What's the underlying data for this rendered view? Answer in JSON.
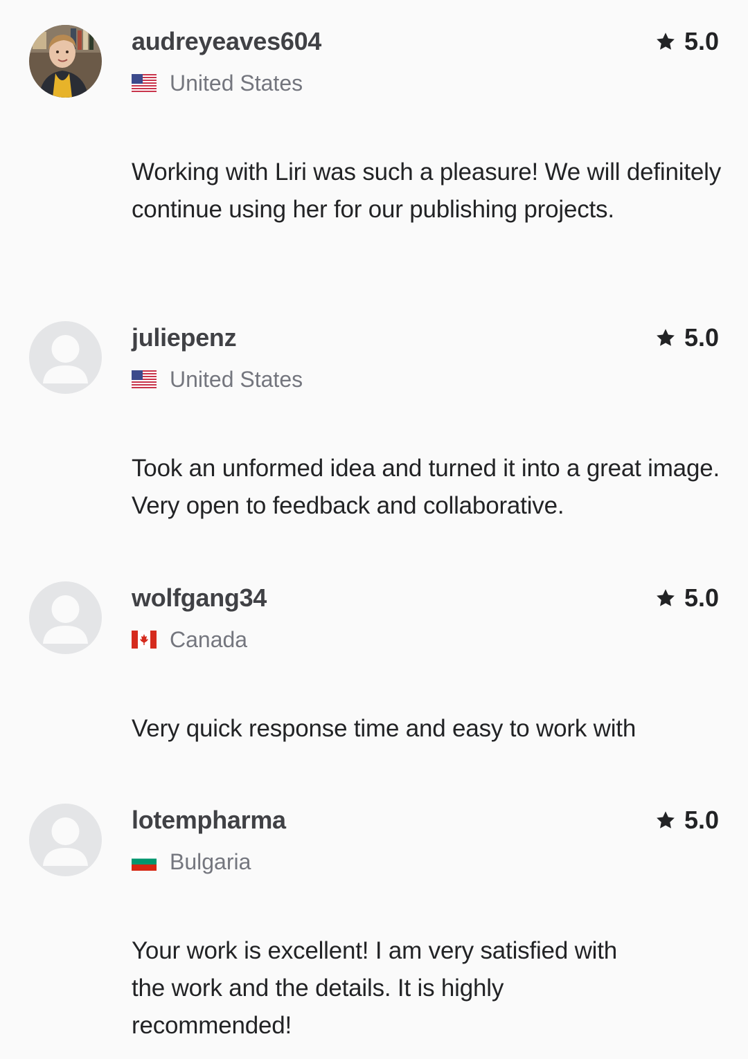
{
  "colors": {
    "background": "#fafafa",
    "username": "#404145",
    "text": "#222325",
    "muted": "#74767e",
    "placeholder_avatar": "#e4e5e7"
  },
  "reviews": [
    {
      "username": "audreyeaves604",
      "country": "United States",
      "flag": "us-flag",
      "rating": "5.0",
      "avatar": "photo",
      "text": "Working with Liri was such a pleasure! We will definitely continue using her for our publishing projects."
    },
    {
      "username": "juliepenz",
      "country": "United States",
      "flag": "us-flag",
      "rating": "5.0",
      "avatar": "placeholder",
      "text": "Took an unformed idea and turned it into a great image. Very open to feedback and collaborative."
    },
    {
      "username": "wolfgang34",
      "country": "Canada",
      "flag": "canada-flag",
      "rating": "5.0",
      "avatar": "placeholder",
      "text": "Very quick response time and easy to work with"
    },
    {
      "username": "lotempharma",
      "country": "Bulgaria",
      "flag": "bulgaria-flag",
      "rating": "5.0",
      "avatar": "placeholder",
      "text": "Your work is excellent! I am very satisfied with the work and the details. It is highly recommended!"
    }
  ]
}
